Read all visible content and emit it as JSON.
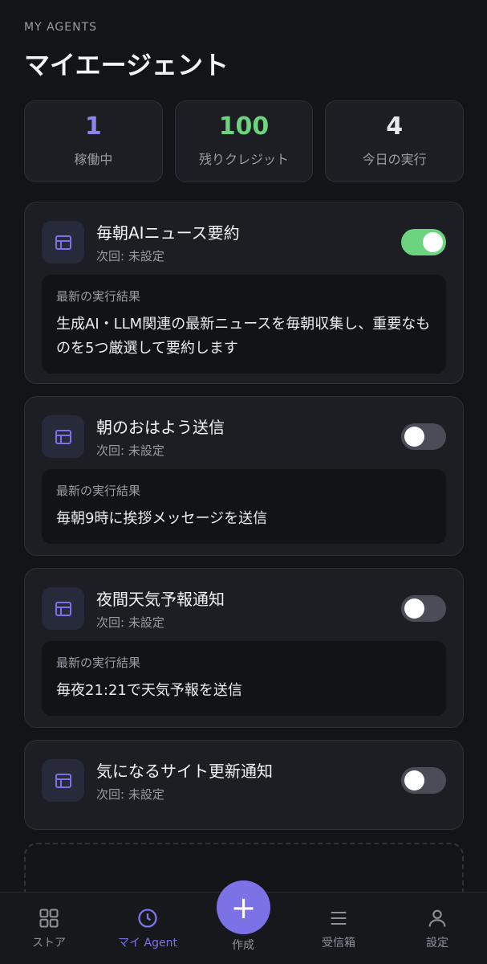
{
  "header": {
    "eyebrow": "MY AGENTS",
    "title": "マイエージェント"
  },
  "stats": [
    {
      "value": "1",
      "label": "稼働中",
      "color": "#8B85EE"
    },
    {
      "value": "100",
      "label": "残りクレジット",
      "color": "#6CD47E"
    },
    {
      "value": "4",
      "label": "今日の実行",
      "color": "#E8E9EE"
    }
  ],
  "agents": [
    {
      "name": "毎朝AIニュース要約",
      "next_run": "次回: 未設定",
      "enabled": true,
      "result_label": "最新の実行結果",
      "result_text": "生成AI・LLM関連の最新ニュースを毎朝収集し、重要なものを5つ厳選して要約します"
    },
    {
      "name": "朝のおはよう送信",
      "next_run": "次回: 未設定",
      "enabled": false,
      "result_label": "最新の実行結果",
      "result_text": "毎朝9時に挨拶メッセージを送信"
    },
    {
      "name": "夜間天気予報通知",
      "next_run": "次回: 未設定",
      "enabled": false,
      "result_label": "最新の実行結果",
      "result_text": "毎夜21:21で天気予報を送信"
    },
    {
      "name": "気になるサイト更新通知",
      "next_run": "次回: 未設定",
      "enabled": false
    }
  ],
  "tabbar": {
    "store": "ストア",
    "my_agent": "マイ Agent",
    "create": "作成",
    "inbox": "受信箱",
    "settings": "設定",
    "active_tab": "my_agent",
    "accent": "#7B72E6"
  }
}
